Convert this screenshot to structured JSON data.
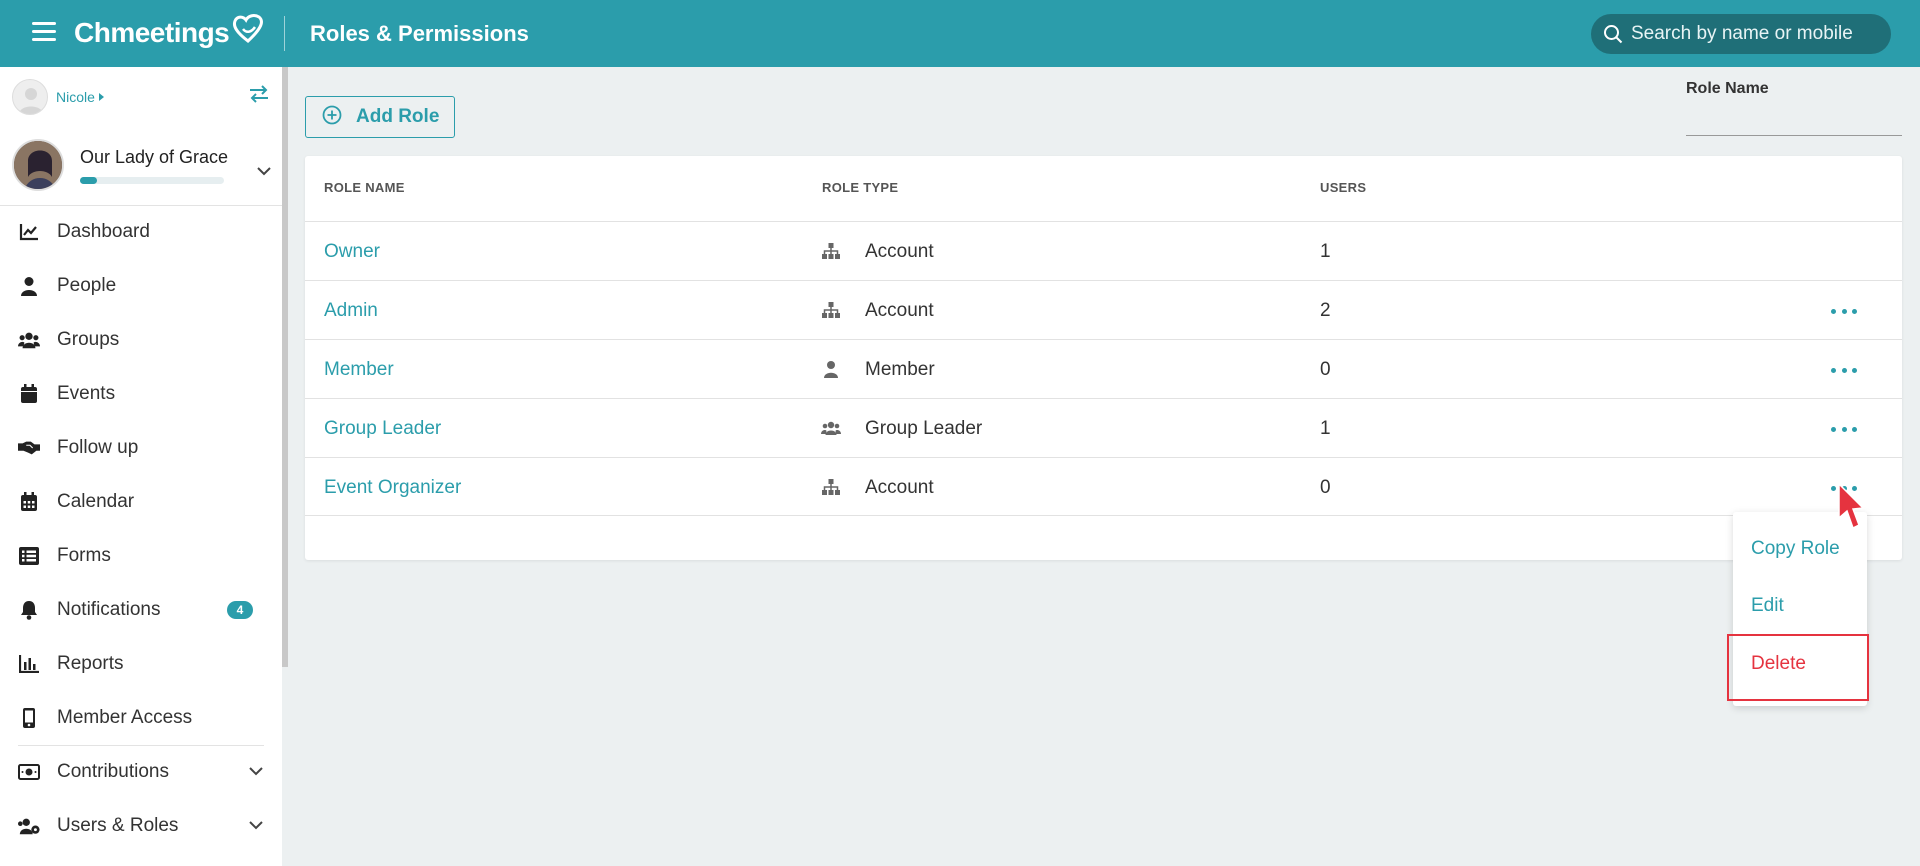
{
  "header": {
    "app_name": "Chmeetings",
    "page_title": "Roles & Permissions",
    "search_placeholder": "Search by name or mobile"
  },
  "sidebar": {
    "user_name": "Nicole",
    "church_name": "Our Lady of Grace",
    "setup_progress": 0.12,
    "nav_items": [
      {
        "label": "Dashboard",
        "icon": "chart-line-icon"
      },
      {
        "label": "People",
        "icon": "person-icon"
      },
      {
        "label": "Groups",
        "icon": "users-icon"
      },
      {
        "label": "Events",
        "icon": "calendar-icon"
      },
      {
        "label": "Follow up",
        "icon": "handshake-icon"
      },
      {
        "label": "Calendar",
        "icon": "calendar-grid-icon"
      },
      {
        "label": "Forms",
        "icon": "list-icon"
      },
      {
        "label": "Notifications",
        "icon": "bell-icon",
        "badge": "4"
      },
      {
        "label": "Reports",
        "icon": "bar-chart-icon"
      },
      {
        "label": "Member Access",
        "icon": "mobile-icon"
      },
      {
        "label": "Contributions",
        "icon": "money-icon"
      },
      {
        "label": "Users & Roles",
        "icon": "users-cog-icon"
      }
    ]
  },
  "main": {
    "add_role_label": "Add Role",
    "filter_label": "Role Name",
    "table": {
      "headers": [
        "ROLE NAME",
        "ROLE TYPE",
        "USERS"
      ],
      "rows": [
        {
          "name": "Owner",
          "type": "Account",
          "type_icon": "sitemap-icon",
          "users": "1"
        },
        {
          "name": "Admin",
          "type": "Account",
          "type_icon": "sitemap-icon",
          "users": "2"
        },
        {
          "name": "Member",
          "type": "Member",
          "type_icon": "person-icon",
          "users": "0"
        },
        {
          "name": "Group Leader",
          "type": "Group Leader",
          "type_icon": "users-icon",
          "users": "1"
        },
        {
          "name": "Event Organizer",
          "type": "Account",
          "type_icon": "sitemap-icon",
          "users": "0"
        }
      ]
    },
    "row_menu": {
      "copy_label": "Copy Role",
      "edit_label": "Edit",
      "delete_label": "Delete"
    }
  },
  "colors": {
    "brand": "#2b9dab",
    "danger": "#e5333f",
    "background": "#ecf0f1"
  }
}
